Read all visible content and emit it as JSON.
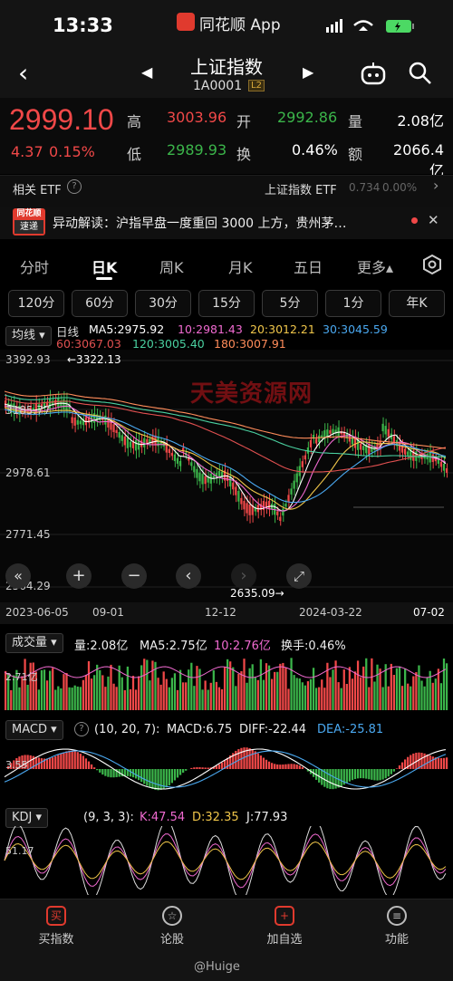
{
  "status": {
    "time": "13:33",
    "app_name": "同花顺 App"
  },
  "header": {
    "title": "上证指数",
    "code": "1A0001",
    "badge": "L2"
  },
  "quote": {
    "price": "2999.10",
    "change": "4.37",
    "change_pct": "0.15%",
    "high_label": "高",
    "high": "3003.96",
    "open_label": "开",
    "open": "2992.86",
    "volume_label": "量",
    "volume": "2.08亿",
    "low_label": "低",
    "low": "2989.93",
    "turnover_label": "换",
    "turnover": "0.46%",
    "amount_label": "额",
    "amount": "2066.4亿"
  },
  "etf": {
    "label": "相关 ETF",
    "name": "上证指数 ETF",
    "price": "0.734",
    "pct": "0.00%"
  },
  "news": {
    "logo_top": "同花顺",
    "logo_bottom": "速递",
    "text": "异动解读：沪指早盘一度重回 3000 上方，贵州茅…"
  },
  "tabs": [
    "分时",
    "日K",
    "周K",
    "月K",
    "五日",
    "更多▴"
  ],
  "active_tab": "日K",
  "periods": [
    "120分",
    "60分",
    "30分",
    "15分",
    "5分",
    "1分",
    "年K"
  ],
  "kline": {
    "selector": "均线",
    "series_label": "日线",
    "ma5": "MA5:2975.92",
    "ma10": "10:2981.43",
    "ma20": "20:3012.21",
    "ma30": "30:3045.59",
    "ma60": "60:3067.03",
    "ma120": "120:3005.40",
    "ma180": "180:3007.91",
    "y_top": "3392.93",
    "y_mid1": "3185.77",
    "y_mid2": "2978.61",
    "y_mid3": "2771.45",
    "y_bottom": "2564.29",
    "max_marker": "←3322.13",
    "min_marker": "2635.09→",
    "watermark": "天美资源网",
    "x_labels": [
      "2023-06-05",
      "09-01",
      "12-12",
      "2024-03-22",
      "07-02"
    ],
    "controls": [
      "«",
      "+",
      "−",
      "‹",
      "›",
      "⤢"
    ]
  },
  "volume": {
    "selector": "成交量",
    "vol": "量:2.08亿",
    "ma5": "MA5:2.75亿",
    "ma10": "10:2.76亿",
    "turn": "换手:0.46%",
    "axis": "2.71亿"
  },
  "macd": {
    "selector": "MACD",
    "params": "(10, 20, 7):",
    "macd": "MACD:6.75",
    "diff": "DIFF:-22.44",
    "dea": "DEA:-25.81",
    "axis": "3.55"
  },
  "kdj": {
    "selector": "KDJ",
    "params": "(9, 3, 3):",
    "k": "K:47.54",
    "d": "D:32.35",
    "j": "J:77.93",
    "axis": "51.17"
  },
  "bottom_nav": [
    {
      "label": "买指数",
      "icon": "买"
    },
    {
      "label": "论股",
      "icon": "☆"
    },
    {
      "label": "加自选",
      "icon": "+"
    },
    {
      "label": "功能",
      "icon": "≡"
    }
  ],
  "footer_watermark": "@Huige",
  "colors": {
    "up": "#f04848",
    "down": "#3bb54a",
    "ma5": "#ffffff",
    "ma10": "#f06ad0",
    "ma20": "#f0c64a",
    "ma30": "#4aa8f0",
    "ma60": "#e05050",
    "ma120": "#4ad0a0",
    "ma180": "#ff8c5a"
  }
}
